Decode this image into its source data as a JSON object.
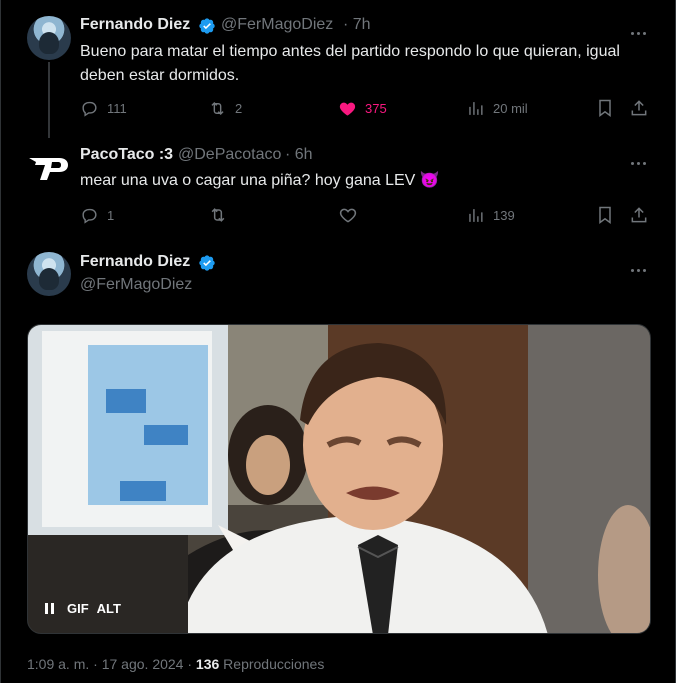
{
  "tweets": [
    {
      "name": "Fernando Diez",
      "handle": "@FerMagoDiez",
      "time": "· 7h",
      "text": "Bueno para matar el tiempo antes del partido respondo lo que quieran, igual deben estar dormidos.",
      "replies": "111",
      "retweets": "2",
      "likes": "375",
      "views": "20 mil"
    },
    {
      "name": "PacoTaco :3",
      "handle": "@DePacotaco",
      "time": "· 6h",
      "text": "mear una uva o cagar una piña? hoy gana LEV 😈",
      "replies": "1",
      "views": "139"
    }
  ],
  "main_tweet": {
    "name": "Fernando Diez",
    "handle": "@FerMagoDiez",
    "media_labels": {
      "gif": "GIF",
      "alt": "ALT"
    },
    "time": "1:09 a. m.",
    "sep": "·",
    "date": "17 ago. 2024",
    "views_count": "136",
    "views_label": "Reproducciones"
  },
  "colors": {
    "accent": "#1d9bf0",
    "like": "#f91880",
    "muted": "#71767b",
    "background": "#000000"
  }
}
